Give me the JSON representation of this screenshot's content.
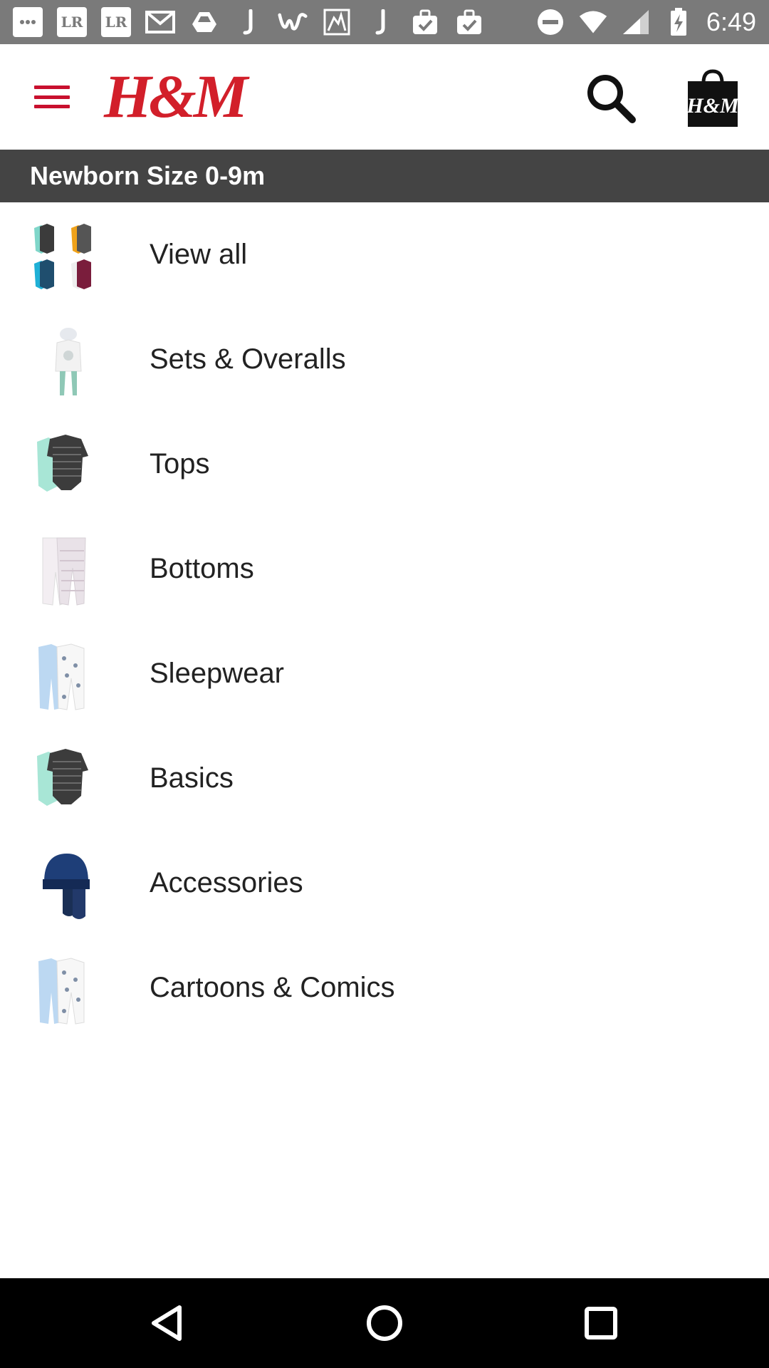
{
  "status_bar": {
    "time": "6:49",
    "left_icons": [
      "more-icon",
      "lr-icon",
      "lr-icon",
      "gmail-icon",
      "drive-icon",
      "j-icon",
      "w-icon",
      "photo-icon",
      "j-icon",
      "bag-check-icon",
      "bag-check-icon"
    ],
    "lr_label": "LR",
    "right_icons": [
      "dnd-icon",
      "wifi-icon",
      "signal-icon",
      "battery-charging-icon"
    ]
  },
  "header": {
    "logo_text": "H&M",
    "brand_color": "#d21f2a",
    "bag_logo_text": "H&M"
  },
  "category": {
    "title": "Newborn Size 0-9m"
  },
  "items": [
    {
      "label": "View all",
      "thumb": "bodysuit-grid-thumbnail"
    },
    {
      "label": "Sets & Overalls",
      "thumb": "set-overall-thumbnail"
    },
    {
      "label": "Tops",
      "thumb": "striped-bodysuit-thumbnail"
    },
    {
      "label": "Bottoms",
      "thumb": "leggings-thumbnail"
    },
    {
      "label": "Sleepwear",
      "thumb": "pajamas-thumbnail"
    },
    {
      "label": "Basics",
      "thumb": "basics-bodysuit-thumbnail"
    },
    {
      "label": "Accessories",
      "thumb": "hat-mittens-thumbnail"
    },
    {
      "label": "Cartoons & Comics",
      "thumb": "cartoon-pajamas-thumbnail"
    }
  ],
  "colors": {
    "status_bar": "#7a7a7a",
    "title_bar": "#444444",
    "menu_accent": "#c8102e",
    "nav_bar": "#000000"
  }
}
